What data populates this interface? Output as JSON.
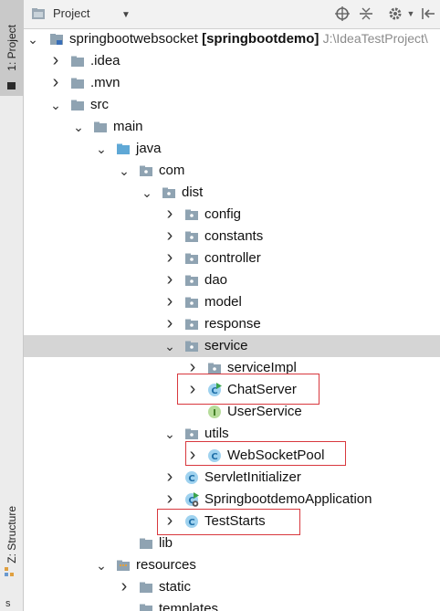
{
  "sidebar": {
    "project_tab": "1: Project",
    "structure_tab": "Z: Structure",
    "bottom_char": "s"
  },
  "toolbar": {
    "label": "Project",
    "icons": [
      "project-icon",
      "dropdown-arrow-icon",
      "locate-icon",
      "collapse-all-icon",
      "gear-icon",
      "hide-icon"
    ]
  },
  "tree": {
    "root": {
      "name": "springbootwebsocket",
      "module": "[springbootdemo]",
      "path": "J:\\IdeaTestProject\\"
    },
    "items": [
      {
        "label": ".idea",
        "type": "folder",
        "expand": "collapsed"
      },
      {
        "label": ".mvn",
        "type": "folder",
        "expand": "collapsed"
      },
      {
        "label": "src",
        "type": "folder",
        "expand": "expanded"
      },
      {
        "label": "main",
        "type": "folder",
        "expand": "expanded"
      },
      {
        "label": "java",
        "type": "source-folder",
        "expand": "expanded"
      },
      {
        "label": "com",
        "type": "package",
        "expand": "expanded"
      },
      {
        "label": "dist",
        "type": "package",
        "expand": "expanded"
      },
      {
        "label": "config",
        "type": "package",
        "expand": "collapsed"
      },
      {
        "label": "constants",
        "type": "package",
        "expand": "collapsed"
      },
      {
        "label": "controller",
        "type": "package",
        "expand": "collapsed"
      },
      {
        "label": "dao",
        "type": "package",
        "expand": "collapsed"
      },
      {
        "label": "model",
        "type": "package",
        "expand": "collapsed"
      },
      {
        "label": "response",
        "type": "package",
        "expand": "collapsed"
      },
      {
        "label": "service",
        "type": "package",
        "expand": "expanded",
        "selected": true
      },
      {
        "label": "serviceImpl",
        "type": "package",
        "expand": "collapsed"
      },
      {
        "label": "ChatServer",
        "type": "class-run",
        "expand": "collapsed"
      },
      {
        "label": "UserService",
        "type": "interface",
        "expand": "none"
      },
      {
        "label": "utils",
        "type": "package",
        "expand": "expanded"
      },
      {
        "label": "WebSocketPool",
        "type": "class",
        "expand": "collapsed"
      },
      {
        "label": "ServletInitializer",
        "type": "class",
        "expand": "collapsed"
      },
      {
        "label": "SpringbootdemoApplication",
        "type": "class-spring",
        "expand": "collapsed"
      },
      {
        "label": "TestStarts",
        "type": "class",
        "expand": "collapsed"
      },
      {
        "label": "lib",
        "type": "folder",
        "expand": "none"
      },
      {
        "label": "resources",
        "type": "resources-folder",
        "expand": "expanded"
      },
      {
        "label": "static",
        "type": "folder",
        "expand": "collapsed"
      },
      {
        "label": "templates",
        "type": "folder",
        "expand": "none"
      }
    ]
  },
  "colors": {
    "highlight_box": "#d8383e",
    "selection": "#d5d5d5",
    "class_icon": "#4aa3d8",
    "interface_icon": "#7ec06a",
    "folder": "#8fa3b2",
    "source_folder": "#5fa8d6"
  }
}
